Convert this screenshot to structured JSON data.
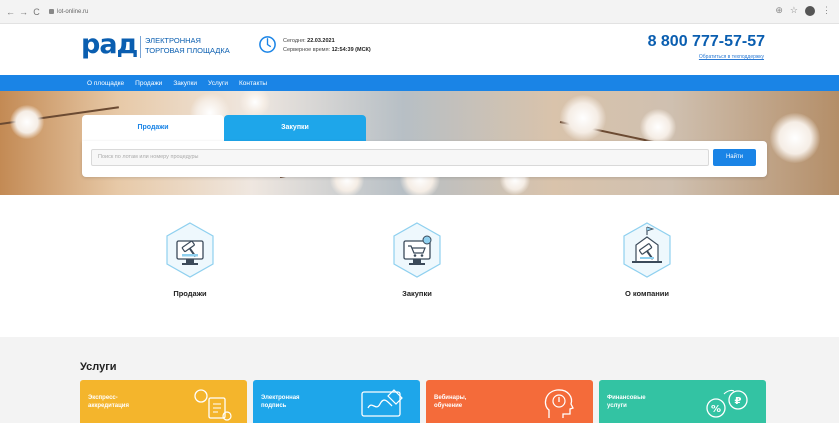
{
  "browser": {
    "address": "lot-online.ru",
    "back": "←",
    "forward": "→",
    "reload": "C",
    "zoom": "⊕",
    "star": "☆",
    "menu": "⋮"
  },
  "header": {
    "logo": "рад",
    "logo_sub_line1": "ЭЛЕКТРОННАЯ",
    "logo_sub_line2": "ТОРГОВАЯ ПЛОЩАДКА",
    "date_label": "Сегодня:",
    "date_value": "22.03.2021",
    "time_label": "Серверное время:",
    "time_value": "12:54:39 (МСК)",
    "phone": "8 800 777-57-57",
    "callback": "Обратиться в техподдержку"
  },
  "nav": {
    "items": [
      "О площадке",
      "Продажи",
      "Закупки",
      "Услуги",
      "Контакты"
    ]
  },
  "search": {
    "tabs": [
      "Продажи",
      "Закупки"
    ],
    "placeholder": "Поиск по лотам или номеру процедуры",
    "button": "Найти"
  },
  "features": [
    {
      "label": "Продажи",
      "icon": "auction-hammer-monitor-icon"
    },
    {
      "label": "Закупки",
      "icon": "shopping-cart-monitor-icon"
    },
    {
      "label": "О компании",
      "icon": "building-hammer-icon"
    }
  ],
  "services": {
    "title": "Услуги",
    "items": [
      {
        "line1": "Экспресс-",
        "line2": "аккредитация",
        "color": "#f4b52c"
      },
      {
        "line1": "Электронная",
        "line2": "подпись",
        "color": "#1ea6ea"
      },
      {
        "line1": "Вебинары,",
        "line2": "обучение",
        "color": "#f46b3a"
      },
      {
        "line1": "Финансовые",
        "line2": "услуги",
        "color": "#33c3a3"
      }
    ]
  },
  "colors": {
    "brand": "#0a5eb0",
    "nav": "#1a84e6",
    "accent": "#1ea6ea"
  }
}
